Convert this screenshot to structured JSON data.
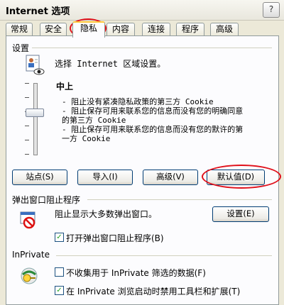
{
  "window": {
    "title": "Internet 选项",
    "help_icon": "help-icon"
  },
  "tabs": [
    {
      "label": "常规"
    },
    {
      "label": "安全"
    },
    {
      "label": "隐私",
      "active": true
    },
    {
      "label": "内容"
    },
    {
      "label": "连接"
    },
    {
      "label": "程序"
    },
    {
      "label": "高级"
    }
  ],
  "settings": {
    "section_title": "设置",
    "intro": "选择 Internet 区域设置。",
    "level_title": "中上",
    "descriptions": [
      "- 阻止没有紧凑隐私政策的第三方 Cookie",
      "- 阻止保存可用来联系您的信息而没有您的明确同意",
      "的第三方 Cookie",
      "- 阻止保存可用来联系您的信息而没有您的默许的第",
      "一方 Cookie"
    ],
    "buttons": {
      "sites": "站点(S)",
      "import": "导入(I)",
      "advanced": "高级(V)",
      "default": "默认值(D)"
    }
  },
  "popup": {
    "section_title": "弹出窗口阻止程序",
    "text": "阻止显示大多数弹出窗口。",
    "settings_button": "设置(E)",
    "checkbox_label": "打开弹出窗口阻止程序(B)",
    "checkbox_checked": true
  },
  "inprivate": {
    "section_title": "InPrivate",
    "option1_label": "不收集用于 InPrivate 筛选的数据(F)",
    "option1_checked": false,
    "option2_label": "在 InPrivate 浏览启动时禁用工具栏和扩展(T)",
    "option2_checked": true
  },
  "colors": {
    "highlight_circle": "#e0101a",
    "dialog_bg": "#ece9d8",
    "panel_bg": "#fcfcfe"
  }
}
